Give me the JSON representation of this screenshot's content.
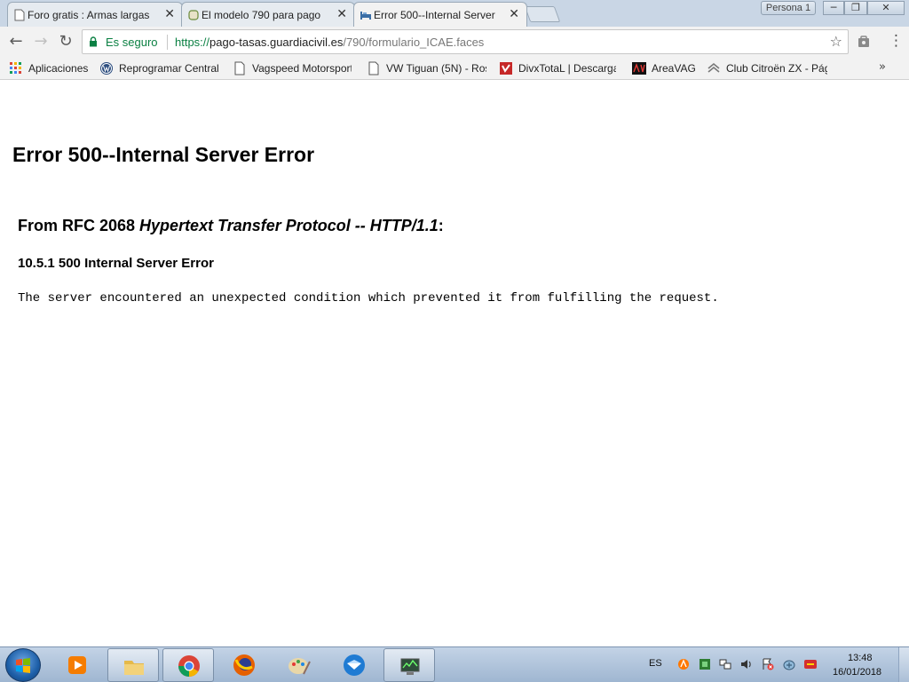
{
  "window": {
    "profile_label": "Persona 1",
    "controls": {
      "minimize": "─",
      "maximize": "❐",
      "close": "✕"
    }
  },
  "tabs": [
    {
      "title": "Foro gratis : Armas largas",
      "icon": "document-icon",
      "active": false
    },
    {
      "title": "El modelo 790 para pago",
      "icon": "forum-icon",
      "active": false
    },
    {
      "title": "Error 500--Internal Server",
      "icon": "bed-icon",
      "active": true
    }
  ],
  "toolbar": {
    "back": "←",
    "forward": "→",
    "reload": "↻",
    "secure_label": "Es seguro",
    "url_scheme": "https://",
    "url_host": "pago-tasas.guardiacivil.es",
    "url_path": "/790/formulario_ICAE.faces",
    "star": "☆",
    "menu": "⋮"
  },
  "bookmarks": {
    "items": [
      {
        "label": "Aplicaciones",
        "icon": "apps-grid-icon"
      },
      {
        "label": "Reprogramar Central",
        "icon": "volkswagen-icon"
      },
      {
        "label": "Vagspeed Motorsport",
        "icon": "page-icon"
      },
      {
        "label": "VW Tiguan (5N) - Ros",
        "icon": "page-icon"
      },
      {
        "label": "DivxTotaL | Descargas",
        "icon": "divxtotal-icon"
      },
      {
        "label": "AreaVAG",
        "icon": "areavag-icon"
      },
      {
        "label": "Club Citroën ZX - Pág",
        "icon": "citroen-icon"
      }
    ],
    "more": "»"
  },
  "page": {
    "title": "Error 500--Internal Server Error",
    "rfc_prefix": "From RFC 2068 ",
    "rfc_italic": "Hypertext Transfer Protocol -- HTTP/1.1",
    "rfc_suffix": ":",
    "subheading": "10.5.1 500 Internal Server Error",
    "message": "The server encountered an unexpected condition which prevented it from fulfilling the request."
  },
  "taskbar": {
    "language": "ES",
    "time": "13:48",
    "date": "16/01/2018",
    "apps": [
      "media-player-icon",
      "file-explorer-icon",
      "chrome-icon",
      "firefox-icon",
      "paint-icon",
      "thunderbird-icon",
      "network-monitor-icon"
    ]
  }
}
